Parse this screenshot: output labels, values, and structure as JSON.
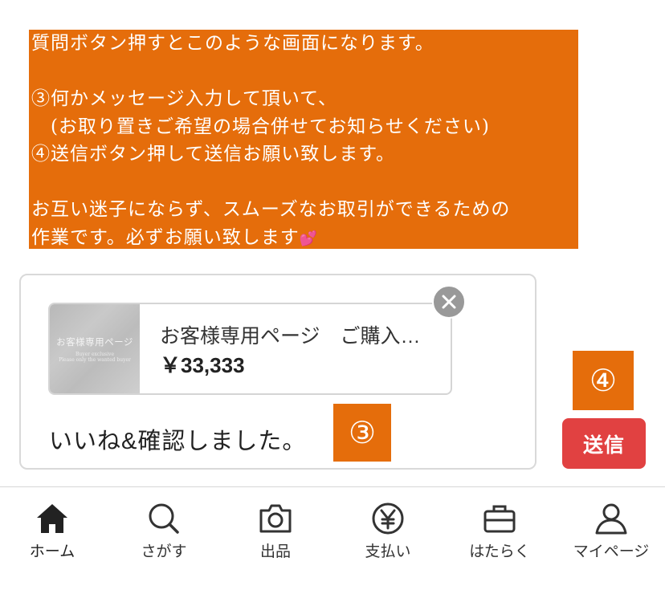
{
  "instruction": {
    "lines": [
      "質問ボタン押すとこのような画面になります。",
      "",
      "③何かメッセージ入力して頂いて、",
      "　(お取り置きご希望の場合併せてお知らせください)",
      "④送信ボタン押して送信お願い致します。",
      "",
      "お互い迷子にならず、スムーズなお取引ができるための",
      "作業です。必ずお願い致します"
    ],
    "heart_emoji": "💕"
  },
  "item_card": {
    "thumbnail_text": "お客様専用ページ",
    "thumbnail_subtext_1": "Buyer exclusive",
    "thumbnail_subtext_2": "Please only the wanted buyer",
    "title": "お客様専用ページ　ご購入…",
    "price": "￥33,333"
  },
  "message": {
    "value": "いいね&確認しました。"
  },
  "annotations": {
    "step3": "③",
    "step4": "④"
  },
  "send_button": {
    "label": "送信"
  },
  "tabbar": {
    "items": [
      {
        "label": "ホーム",
        "icon": "home-icon"
      },
      {
        "label": "さがす",
        "icon": "search-icon"
      },
      {
        "label": "出品",
        "icon": "camera-icon"
      },
      {
        "label": "支払い",
        "icon": "yen-icon"
      },
      {
        "label": "はたらく",
        "icon": "briefcase-icon"
      },
      {
        "label": "マイページ",
        "icon": "person-icon"
      }
    ]
  },
  "colors": {
    "accent_orange": "#e56d0b",
    "send_red": "#e14141",
    "close_gray": "#999999"
  }
}
